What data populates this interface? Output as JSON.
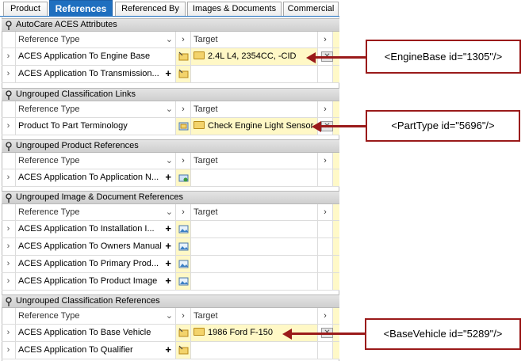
{
  "tabs": [
    "Product",
    "References",
    "Referenced By",
    "Images & Documents",
    "Commercial"
  ],
  "columns": {
    "reference_type": "Reference Type",
    "target": "Target"
  },
  "sections": [
    {
      "title": "AutoCare ACES Attributes",
      "rows": [
        {
          "type": "ACES Application To Engine Base",
          "target": "2.4L L4, 2354CC, -CID"
        },
        {
          "type": "ACES Application To Transmission...",
          "target": ""
        }
      ]
    },
    {
      "title": "Ungrouped Classification Links",
      "rows": [
        {
          "type": "Product To Part Terminology",
          "target": "Check Engine Light Sensor"
        }
      ]
    },
    {
      "title": "Ungrouped Product References",
      "rows": [
        {
          "type": "ACES Application To Application N...",
          "target": ""
        }
      ]
    },
    {
      "title": "Ungrouped Image & Document References",
      "rows": [
        {
          "type": "ACES Application To Installation I...",
          "target": ""
        },
        {
          "type": "ACES Application To Owners Manual",
          "target": ""
        },
        {
          "type": "ACES Application To Primary Prod...",
          "target": ""
        },
        {
          "type": "ACES Application To Product Image",
          "target": ""
        }
      ]
    },
    {
      "title": "Ungrouped Classification References",
      "rows": [
        {
          "type": "ACES Application To Base Vehicle",
          "target": "1986 Ford F-150"
        },
        {
          "type": "ACES Application To Qualifier",
          "target": ""
        }
      ]
    }
  ],
  "annotations": [
    "<EngineBase id=\"1305\"/>",
    "<PartType id=\"5696\"/>",
    "<BaseVehicle id=\"5289\"/>"
  ],
  "colors": {
    "active_tab": "#1f6fbf",
    "callout_border": "#9a1a1a",
    "target_fill": "#fff8c6"
  }
}
